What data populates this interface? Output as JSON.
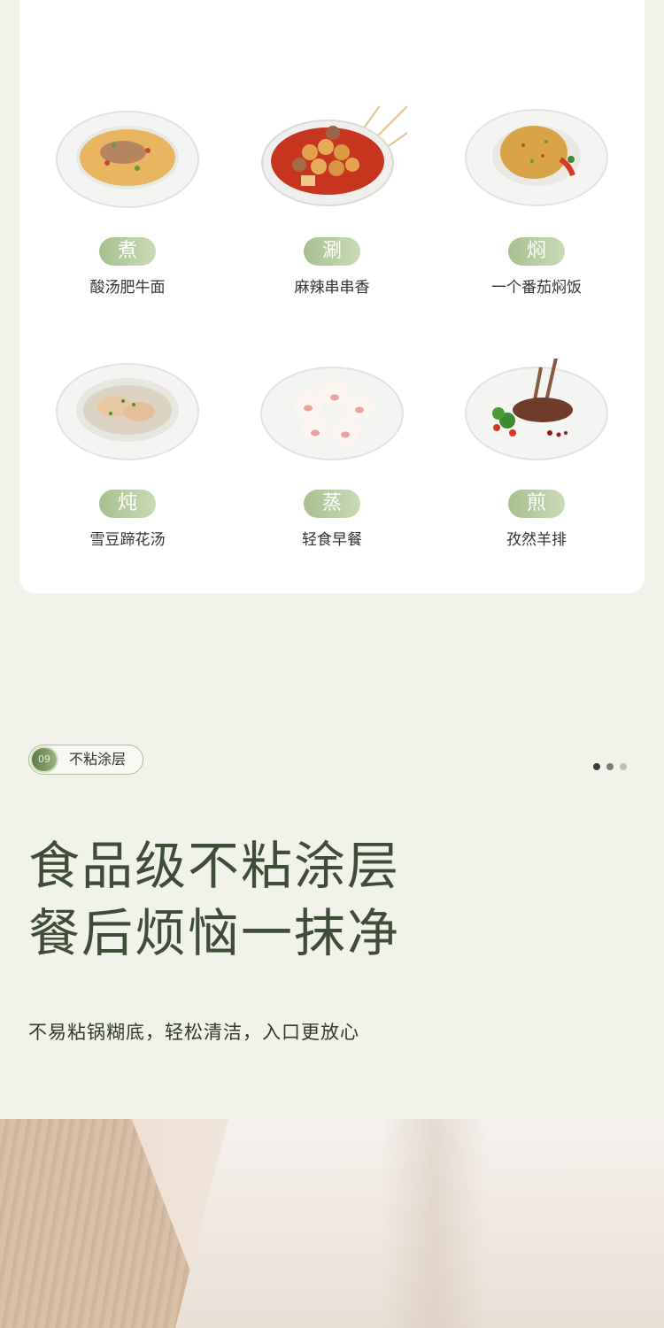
{
  "dishes": [
    {
      "method": "煮",
      "name": "酸汤肥牛面"
    },
    {
      "method": "涮",
      "name": "麻辣串串香"
    },
    {
      "method": "焖",
      "name": "一个番茄焖饭"
    },
    {
      "method": "炖",
      "name": "雪豆蹄花汤"
    },
    {
      "method": "蒸",
      "name": "轻食早餐"
    },
    {
      "method": "煎",
      "name": "孜然羊排"
    }
  ],
  "feature": {
    "number": "09",
    "tag_label": "不粘涂层",
    "headline_line1": "食品级不粘涂层",
    "headline_line2": "餐后烦恼一抹净",
    "subtext": "不易粘锅糊底，轻松清洁，入口更放心"
  },
  "colors": {
    "background": "#f1f2ea",
    "accent_green": "#a7c08e",
    "headline": "#3e4d35"
  }
}
